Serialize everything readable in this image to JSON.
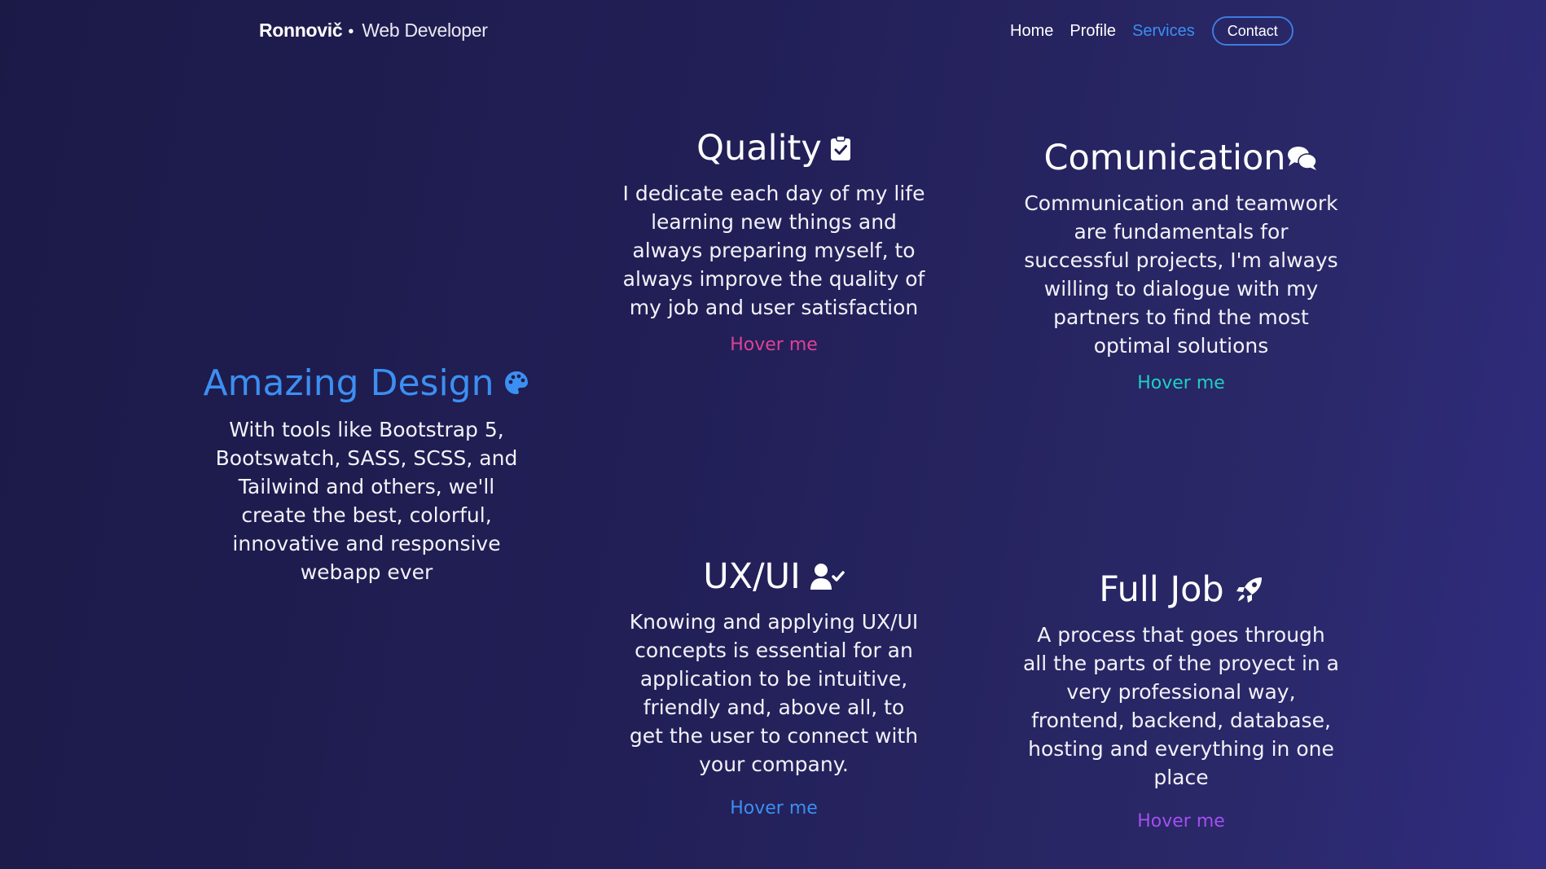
{
  "header": {
    "brand_name": "Ronnovič",
    "separator": "•",
    "brand_role": "Web Developer",
    "nav": {
      "home": "Home",
      "profile": "Profile",
      "services": "Services",
      "contact": "Contact"
    },
    "active_item": "Services"
  },
  "services": {
    "design": {
      "title": "Amazing Design",
      "icon": "palette-icon",
      "description": "With tools like Bootstrap 5, Bootswatch, SASS, SCSS, and Tailwind and others, we'll create the best, colorful, innovative and responsive webapp ever",
      "title_color": "#3c8ff2"
    },
    "quality": {
      "title": "Quality",
      "icon": "clipboard-check-icon",
      "description": "I dedicate each day of my life learning new things and always preparing myself, to always improve the quality of my job and user satisfaction",
      "link": "Hover me",
      "link_color": "#e04294"
    },
    "communication": {
      "title": "Comunication",
      "icon": "comments-icon",
      "description": "Communication and teamwork are fundamentals for successful projects, I'm always willing to dialogue with my partners to find the most optimal solutions",
      "link": "Hover me",
      "link_color": "#1fd0c4"
    },
    "uxui": {
      "title": "UX/UI",
      "icon": "user-check-icon",
      "description": "Knowing and applying UX/UI concepts is essential for an application to be intuitive, friendly and, above all, to get the user to connect with your company.",
      "link": "Hover me",
      "link_color": "#3c8ff2"
    },
    "fulljob": {
      "title": "Full Job",
      "icon": "rocket-icon",
      "description": "A process that goes through all the parts of the proyect in a very professional way, frontend, backend, database, hosting and everything in one place",
      "link": "Hover me",
      "link_color": "#a34ff0"
    }
  },
  "colors": {
    "background_start": "#1b1a47",
    "background_end": "#302c80",
    "accent": "#3c8ff2"
  }
}
